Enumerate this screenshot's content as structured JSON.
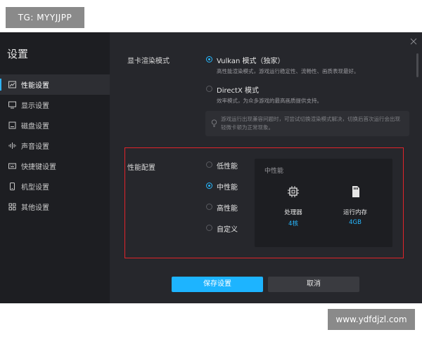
{
  "watermarks": {
    "top": "TG: MYYJJPP",
    "bottom": "www.ydfdjzl.com"
  },
  "sidebar": {
    "title": "设置",
    "items": [
      {
        "label": "性能设置",
        "icon": "performance-icon",
        "active": true
      },
      {
        "label": "显示设置",
        "icon": "display-icon"
      },
      {
        "label": "磁盘设置",
        "icon": "disk-icon"
      },
      {
        "label": "声音设置",
        "icon": "sound-icon"
      },
      {
        "label": "快捷键设置",
        "icon": "keyboard-icon"
      },
      {
        "label": "机型设置",
        "icon": "phone-icon"
      },
      {
        "label": "其他设置",
        "icon": "grid-icon"
      }
    ]
  },
  "render": {
    "label": "显卡渲染模式",
    "options": [
      {
        "name": "Vulkan 模式（独家）",
        "desc": "高性能渲染模式，游戏运行稳定性、流畅性、画质表现最好。",
        "selected": true
      },
      {
        "name": "DirectX 模式",
        "desc": "效率模式，为众多游戏的最高画质提供支持。",
        "selected": false
      }
    ],
    "tip": "游戏运行出现兼容问题时，可尝试切换渲染模式解决，切换后首次运行会出现轻微卡顿为正常现象。"
  },
  "performance": {
    "label": "性能配置",
    "options": [
      {
        "name": "低性能",
        "selected": false
      },
      {
        "name": "中性能",
        "selected": true
      },
      {
        "name": "高性能",
        "selected": false
      },
      {
        "name": "自定义",
        "selected": false
      }
    ],
    "card": {
      "title": "中性能",
      "cpu_label": "处理器",
      "cpu_value": "4核",
      "ram_label": "运行内存",
      "ram_value": "4GB"
    }
  },
  "buttons": {
    "save": "保存设置",
    "cancel": "取消"
  },
  "colors": {
    "accent": "#27b8ff",
    "highlight_box": "#e0242a",
    "window_bg": "#26272c",
    "sidebar_bg": "#1d1e22"
  }
}
